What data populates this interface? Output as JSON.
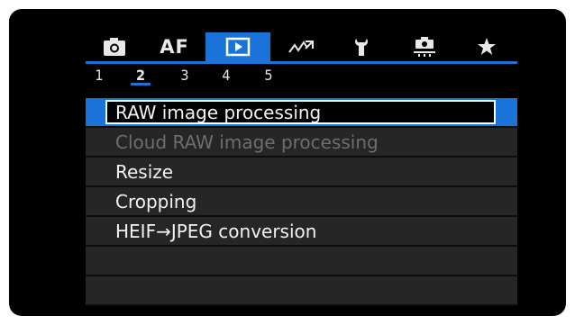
{
  "tabs": [
    {
      "name": "camera-icon",
      "active": false
    },
    {
      "name": "af-label",
      "label": "AF",
      "active": false
    },
    {
      "name": "playback-icon",
      "active": true
    },
    {
      "name": "wireless-icon",
      "active": false
    },
    {
      "name": "setup-wrench-icon",
      "active": false
    },
    {
      "name": "custom-functions-icon",
      "active": false
    },
    {
      "name": "my-menu-star-icon",
      "active": false
    }
  ],
  "pages": {
    "items": [
      "1",
      "2",
      "3",
      "4",
      "5"
    ],
    "active_index": 1
  },
  "menu": {
    "items": [
      {
        "label": "RAW image processing",
        "state": "selected"
      },
      {
        "label": "Cloud RAW image processing",
        "state": "disabled"
      },
      {
        "label": "Resize",
        "state": "normal"
      },
      {
        "label": "Cropping",
        "state": "normal"
      },
      {
        "label": "HEIF→JPEG conversion",
        "state": "normal"
      },
      {
        "label": "",
        "state": "empty"
      },
      {
        "label": "",
        "state": "empty"
      }
    ]
  },
  "colors": {
    "accent": "#1a73d9",
    "background": "#000000",
    "row": "#262626",
    "text": "#f2f2f2",
    "disabled_text": "#6e6e6e"
  }
}
